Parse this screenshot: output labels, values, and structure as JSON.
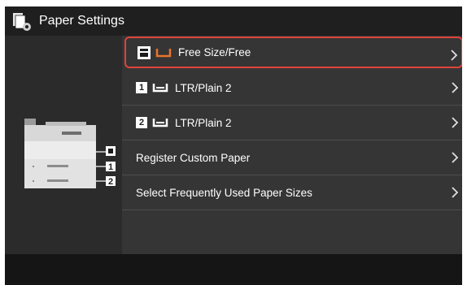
{
  "header": {
    "title": "Paper Settings",
    "icon": "paper-settings-icon"
  },
  "paper_list": {
    "items": [
      {
        "badge": "",
        "source_icon": "multipurpose-tray-icon",
        "tray_color": "#e8732c",
        "label": "Free Size/Free",
        "selected": true
      },
      {
        "badge": "1",
        "source_icon": "drawer-icon",
        "tray_color": "#ffffff",
        "label": "LTR/Plain 2",
        "selected": false
      },
      {
        "badge": "2",
        "source_icon": "drawer-icon",
        "tray_color": "#ffffff",
        "label": "LTR/Plain 2",
        "selected": false
      },
      {
        "badge": "",
        "source_icon": "",
        "label": "Register Custom Paper",
        "selected": false
      },
      {
        "badge": "",
        "source_icon": "",
        "label": "Select Frequently Used Paper Sizes",
        "selected": false
      }
    ]
  },
  "printer_diagram": {
    "icon": "printer-illustration",
    "labels": [
      "1",
      "2"
    ]
  },
  "colors": {
    "selection_border": "#e0433a",
    "accent_tray": "#e8732c"
  }
}
